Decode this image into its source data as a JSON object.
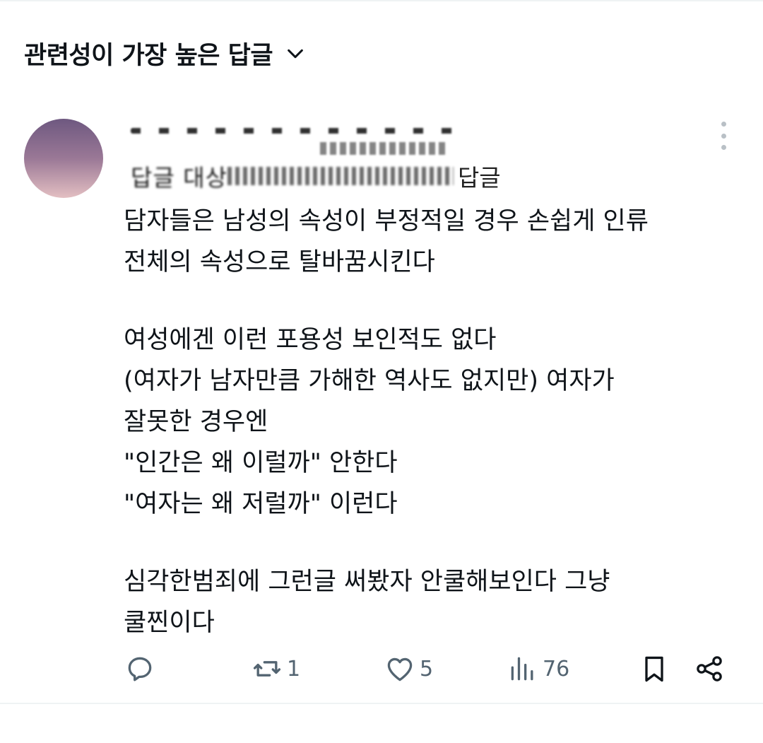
{
  "header": {
    "sort_label": "관련성이 가장 높은 답글"
  },
  "post": {
    "reply_to_prefix": "답글 대상",
    "reply_to_suffix": "답글",
    "body_lines": [
      "담자들은 남성의 속성이 부정적일 경우 손쉽게 인류",
      "전체의 속성으로 탈바꿈시킨다",
      "",
      "여성에겐 이런 포용성 보인적도 없다",
      "(여자가 남자만큼 가해한 역사도 없지만) 여자가",
      "잘못한 경우엔",
      "\"인간은 왜 이럴까\" 안한다",
      "\"여자는 왜 저럴까\" 이런다",
      "",
      "심각한범죄에 그런글 써봤자 안쿨해보인다 그냥",
      "쿨찐이다"
    ]
  },
  "actions": {
    "reply_count": "",
    "repost_count": "1",
    "like_count": "5",
    "views_count": "76"
  },
  "colors": {
    "text": "#0f1419",
    "icon": "#536471",
    "divider": "#eff3f4"
  },
  "icons": [
    "chevron-down-icon",
    "more-icon",
    "reply-icon",
    "repost-icon",
    "like-icon",
    "views-icon",
    "bookmark-icon",
    "share-icon"
  ]
}
